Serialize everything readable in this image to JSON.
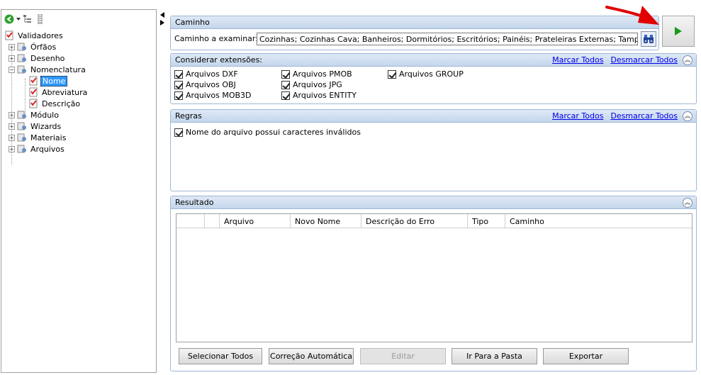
{
  "tree": {
    "root": "Validadores",
    "items": [
      {
        "label": "Órfãos"
      },
      {
        "label": "Desenho"
      },
      {
        "label": "Nomenclatura",
        "children": [
          {
            "label": "Nome"
          },
          {
            "label": "Abreviatura"
          },
          {
            "label": "Descrição"
          }
        ]
      },
      {
        "label": "Módulo"
      },
      {
        "label": "Wizards"
      },
      {
        "label": "Materiais"
      },
      {
        "label": "Arquivos"
      }
    ]
  },
  "caminho": {
    "title": "Caminho",
    "label": "Caminho a examinar:",
    "value": "Cozinhas; Cozinhas Cava; Banheiros; Dormitórios; Escritórios; Painéis; Prateleiras Externas; Tampos/Tamponamentos"
  },
  "extensoes": {
    "title": "Considerar extensões:",
    "mark_all": "Marcar Todos",
    "unmark_all": "Desmarcar Todos",
    "items": [
      "Arquivos DXF",
      "Arquivos OBJ",
      "Arquivos MOB3D",
      "Arquivos PMOB",
      "Arquivos JPG",
      "Arquivos ENTITY",
      "Arquivos GROUP"
    ]
  },
  "regras": {
    "title": "Regras",
    "mark_all": "Marcar Todos",
    "unmark_all": "Desmarcar Todos",
    "items": [
      "Nome do arquivo possui caracteres inválidos"
    ]
  },
  "resultado": {
    "title": "Resultado",
    "columns": [
      "",
      "",
      "Arquivo",
      "Novo Nome",
      "Descrição do Erro",
      "Tipo",
      "Caminho"
    ]
  },
  "buttons": {
    "select_all": "Selecionar Todos",
    "auto_fix": "Correção Automática",
    "edit": "Editar",
    "go_folder": "Ir Para a Pasta",
    "export": "Exportar"
  },
  "colors": {
    "accent_header": "#c4d6ec",
    "link": "#0000ee",
    "selection": "#3399ff",
    "arrow": "#e00000",
    "run": "#1a9a1a"
  }
}
